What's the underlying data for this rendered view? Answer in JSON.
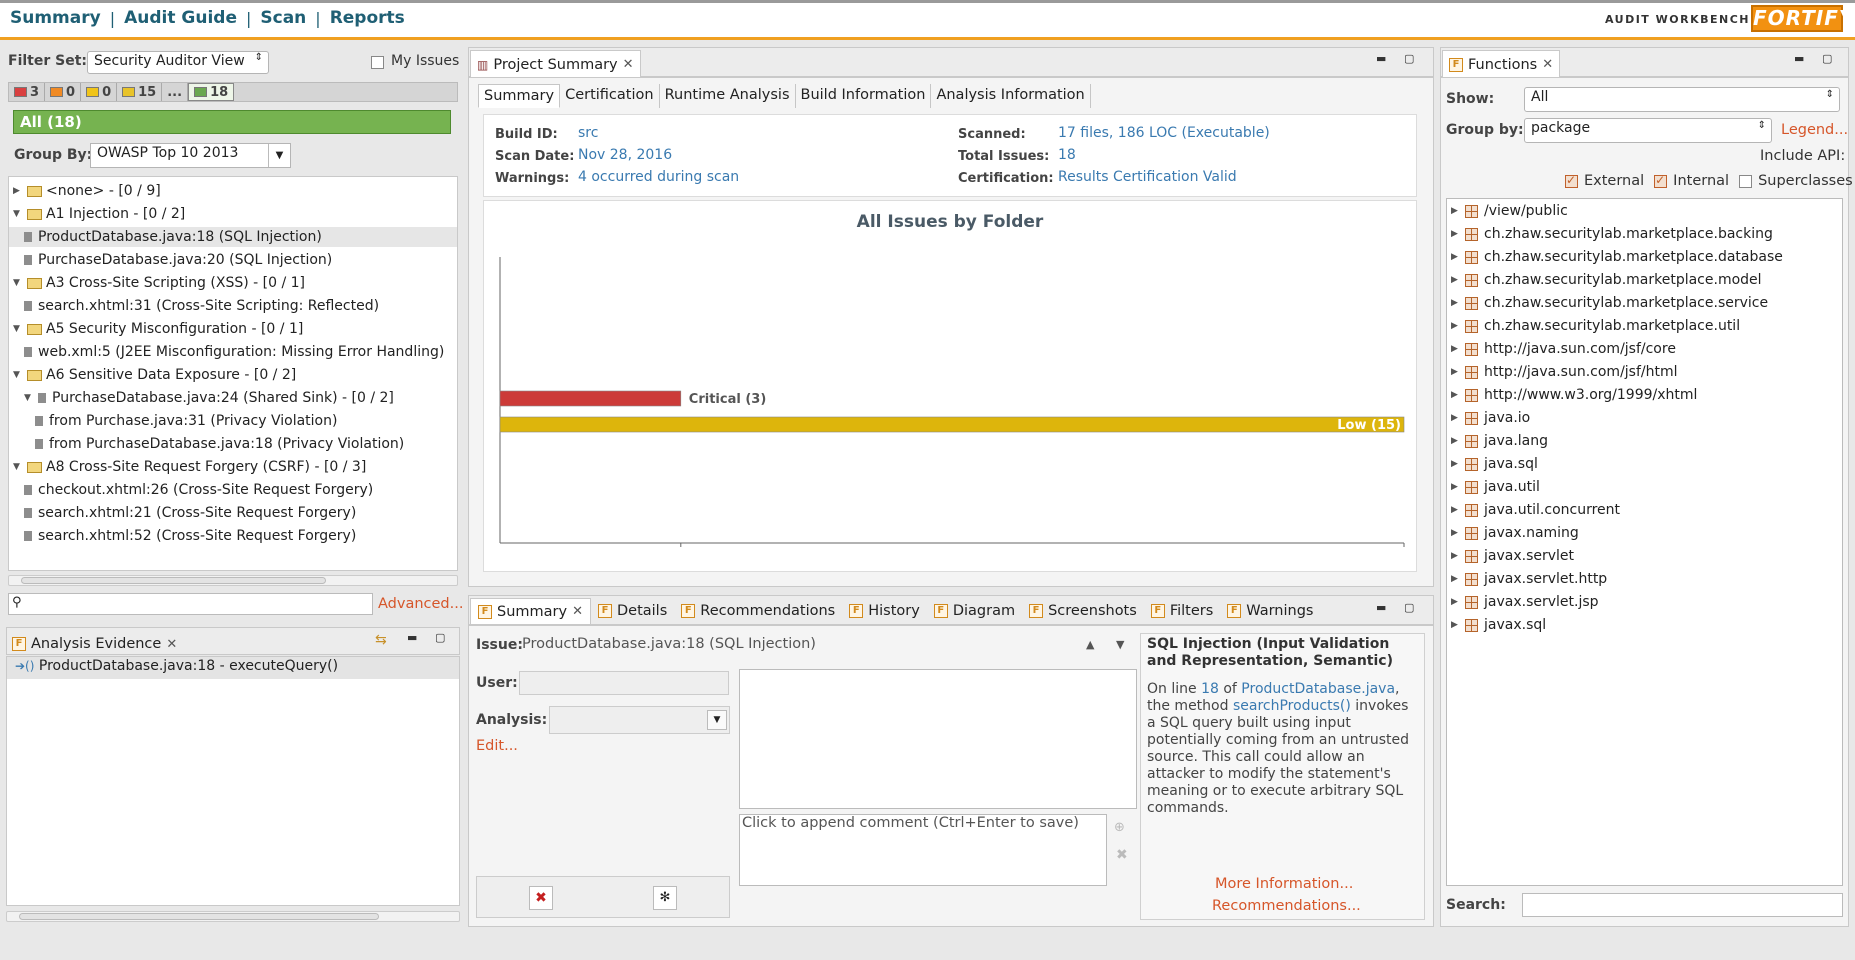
{
  "nav": {
    "summary": "Summary",
    "audit_guide": "Audit Guide",
    "scan": "Scan",
    "reports": "Reports",
    "sep": "|"
  },
  "brand": {
    "subtitle": "AUDIT WORKBENCH",
    "logo": "FORTIFY"
  },
  "issues_panel": {
    "filter_set_label": "Filter Set:",
    "filter_set_value": "Security Auditor View",
    "my_issues_label": "My Issues",
    "counts": [
      {
        "value": "3",
        "color": "#d94040"
      },
      {
        "value": "0",
        "color": "#f08a24"
      },
      {
        "value": "0",
        "color": "#f0c419"
      },
      {
        "value": "15",
        "color": "#e8c32a"
      },
      {
        "value": "...",
        "color": ""
      },
      {
        "value": "18",
        "color": "#6aa84f"
      }
    ],
    "all_label": "All (18)",
    "group_by_label": "Group By:",
    "group_by_value": "OWASP Top 10 2013",
    "tree": [
      {
        "text": "<none> - [0 / 9]",
        "type": "folder",
        "open": false,
        "indent": 0
      },
      {
        "text": "A1 Injection - [0 / 2]",
        "type": "folder",
        "open": true,
        "indent": 0
      },
      {
        "text": "ProductDatabase.java:18 (SQL Injection)",
        "type": "leaf",
        "indent": 1,
        "selected": true
      },
      {
        "text": "PurchaseDatabase.java:20 (SQL Injection)",
        "type": "leaf",
        "indent": 1
      },
      {
        "text": "A3 Cross-Site Scripting (XSS) - [0 / 1]",
        "type": "folder",
        "open": true,
        "indent": 0
      },
      {
        "text": "search.xhtml:31 (Cross-Site Scripting: Reflected)",
        "type": "leaf",
        "indent": 1
      },
      {
        "text": "A5 Security Misconfiguration - [0 / 1]",
        "type": "folder",
        "open": true,
        "indent": 0
      },
      {
        "text": "web.xml:5 (J2EE Misconfiguration: Missing Error Handling)",
        "type": "leaf",
        "indent": 1
      },
      {
        "text": "A6 Sensitive Data Exposure - [0 / 2]",
        "type": "folder",
        "open": true,
        "indent": 0
      },
      {
        "text": "PurchaseDatabase.java:24 (Shared Sink) - [0 / 2]",
        "type": "leafparent",
        "indent": 1
      },
      {
        "text": "from Purchase.java:31 (Privacy Violation)",
        "type": "leaf",
        "indent": 2
      },
      {
        "text": "from PurchaseDatabase.java:18 (Privacy Violation)",
        "type": "leaf",
        "indent": 2
      },
      {
        "text": "A8 Cross-Site Request Forgery (CSRF) - [0 / 3]",
        "type": "folder",
        "open": true,
        "indent": 0
      },
      {
        "text": "checkout.xhtml:26 (Cross-Site Request Forgery)",
        "type": "leaf",
        "indent": 1
      },
      {
        "text": "search.xhtml:21 (Cross-Site Request Forgery)",
        "type": "leaf",
        "indent": 1
      },
      {
        "text": "search.xhtml:52 (Cross-Site Request Forgery)",
        "type": "leaf",
        "indent": 1
      }
    ],
    "advanced": "Advanced..."
  },
  "evidence": {
    "title": "Analysis Evidence",
    "item": "ProductDatabase.java:18 - executeQuery()"
  },
  "project_summary": {
    "title": "Project Summary",
    "tabs": [
      "Summary",
      "Certification",
      "Runtime Analysis",
      "Build Information",
      "Analysis Information"
    ],
    "build_id_label": "Build ID:",
    "build_id": "src",
    "scan_date_label": "Scan Date:",
    "scan_date": "Nov 28, 2016",
    "warnings_label": "Warnings:",
    "warnings": "4 occurred during scan",
    "scanned_label": "Scanned:",
    "scanned": "17 files, 186 LOC (Executable)",
    "total_label": "Total Issues:",
    "total": "18",
    "cert_label": "Certification:",
    "cert": "Results Certification Valid"
  },
  "chart_data": {
    "type": "bar",
    "title": "All Issues by Folder",
    "orientation": "horizontal",
    "categories": [
      "Critical",
      "Low"
    ],
    "values": [
      3,
      15
    ],
    "labels": [
      "Critical (3)",
      "Low (15)"
    ],
    "colors": [
      "#cc3b38",
      "#ddb50c"
    ],
    "xlim": [
      0,
      15
    ]
  },
  "detail": {
    "tabs": [
      "Summary",
      "Details",
      "Recommendations",
      "History",
      "Diagram",
      "Screenshots",
      "Filters",
      "Warnings"
    ],
    "issue_label": "Issue:",
    "issue_value": "ProductDatabase.java:18 (SQL Injection)",
    "user_label": "User:",
    "analysis_label": "Analysis:",
    "edit": "Edit...",
    "comment_placeholder": "Click to append comment (Ctrl+Enter to save)",
    "desc_title": "SQL Injection (Input Validation and Representation, Semantic)",
    "desc_pre": "On line ",
    "desc_line": "18",
    "desc_of": " of ",
    "desc_file": "ProductDatabase.java",
    "desc_mid": ", the method ",
    "desc_method": "searchProducts()",
    "desc_post": " invokes a SQL query built using input potentially coming from an untrusted source. This call could allow an attacker to modify the statement's meaning or to execute arbitrary SQL commands.",
    "more_info": "More Information...",
    "recommendations": "Recommendations..."
  },
  "functions": {
    "title": "Functions",
    "show_label": "Show:",
    "show_value": "All",
    "group_label": "Group by:",
    "group_value": "package",
    "legend": "Legend...",
    "include_api": "Include API:",
    "external": "External",
    "internal": "Internal",
    "superclasses": "Superclasses",
    "packages": [
      "/view/public",
      "ch.zhaw.securitylab.marketplace.backing",
      "ch.zhaw.securitylab.marketplace.database",
      "ch.zhaw.securitylab.marketplace.model",
      "ch.zhaw.securitylab.marketplace.service",
      "ch.zhaw.securitylab.marketplace.util",
      "http://java.sun.com/jsf/core",
      "http://java.sun.com/jsf/html",
      "http://www.w3.org/1999/xhtml",
      "java.io",
      "java.lang",
      "java.sql",
      "java.util",
      "java.util.concurrent",
      "javax.naming",
      "javax.servlet",
      "javax.servlet.http",
      "javax.servlet.jsp",
      "javax.sql"
    ],
    "search_label": "Search:"
  }
}
